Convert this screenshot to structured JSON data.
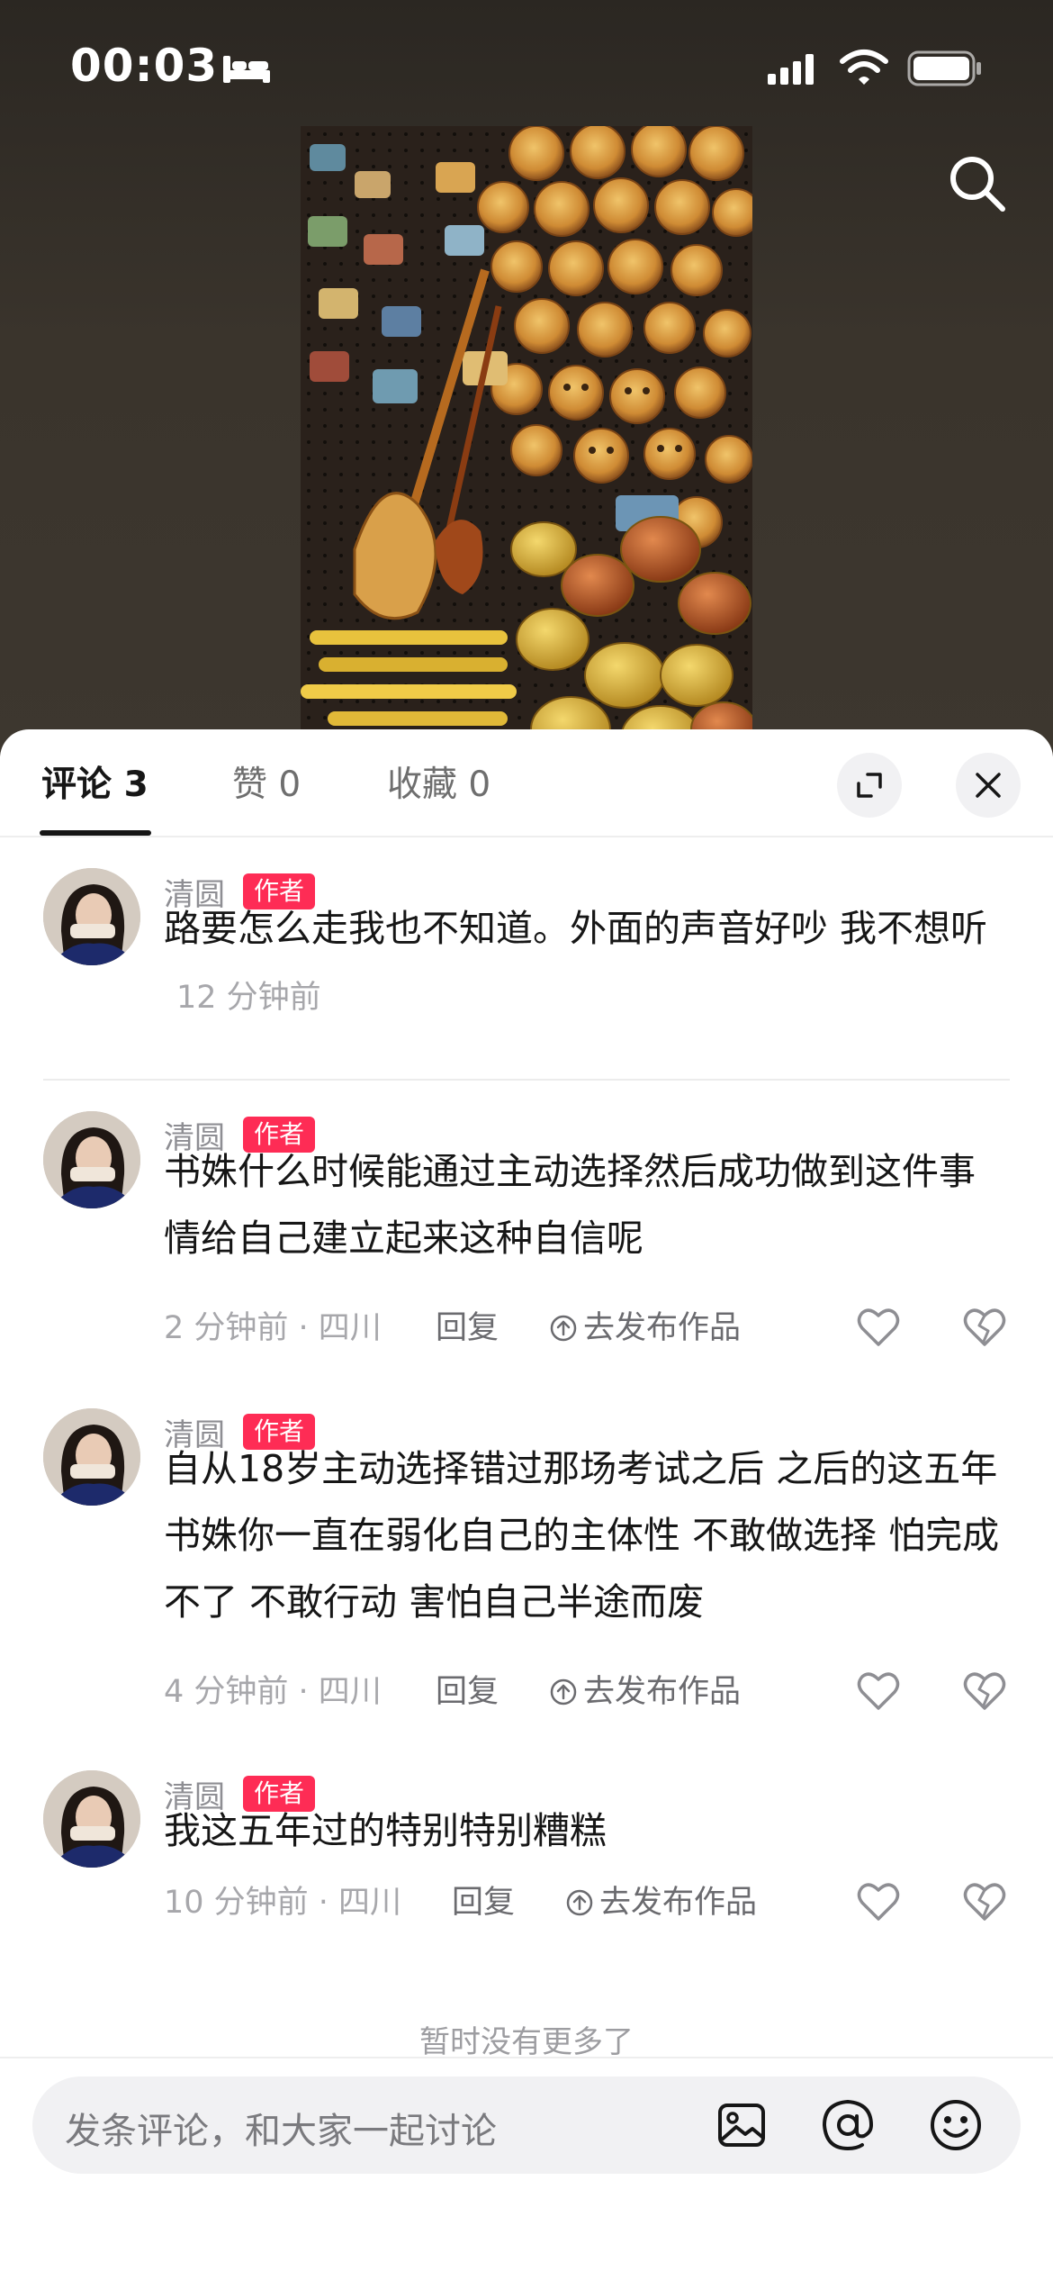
{
  "status_bar": {
    "time": "00:03"
  },
  "tabs": [
    {
      "label": "评论 3",
      "active": true
    },
    {
      "label": "赞 0",
      "active": false
    },
    {
      "label": "收藏 0",
      "active": false
    }
  ],
  "header_icons": {
    "expand": "expand-icon",
    "close": "close-icon",
    "search": "search-icon"
  },
  "comments": [
    {
      "username": "清圆",
      "badge": "作者",
      "text": "路要怎么走我也不知道。外面的声音好吵 我不想听",
      "time": "12 分钟前"
    },
    {
      "username": "清圆",
      "badge": "作者",
      "text": "书姝什么时候能通过主动选择然后成功做到这件事情给自己建立起来这种自信呢",
      "meta": "2 分钟前 · 四川",
      "reply": "回复",
      "publish": "去发布作品"
    },
    {
      "username": "清圆",
      "badge": "作者",
      "text": "自从18岁主动选择错过那场考试之后 之后的这五年 书姝你一直在弱化自己的主体性 不敢做选择 怕完成不了 不敢行动 害怕自己半途而废",
      "meta": "4 分钟前 · 四川",
      "reply": "回复",
      "publish": "去发布作品"
    },
    {
      "username": "清圆",
      "badge": "作者",
      "text": "我这五年过的特别特别糟糕",
      "meta": "10 分钟前 · 四川",
      "reply": "回复",
      "publish": "去发布作品"
    }
  ],
  "no_more_text": "暂时没有更多了",
  "input": {
    "placeholder": "发条评论，和大家一起讨论"
  },
  "colors": {
    "accent": "#fe2c55",
    "text_primary": "#161616",
    "text_secondary": "#a7a7ab"
  }
}
